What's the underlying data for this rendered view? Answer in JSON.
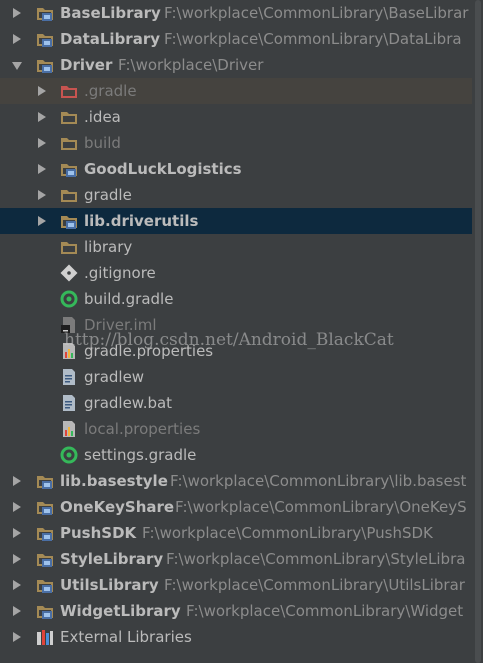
{
  "tree": {
    "BaseLibrary": {
      "label": "BaseLibrary",
      "path": "F:\\workplace\\CommonLibrary\\BaseLibrar"
    },
    "DataLibrary": {
      "label": "DataLibrary",
      "path": "F:\\workplace\\CommonLibrary\\DataLibra"
    },
    "Driver": {
      "label": "Driver",
      "path": "F:\\workplace\\Driver"
    },
    "gradle_hidden": {
      "label": ".gradle"
    },
    "idea": {
      "label": ".idea"
    },
    "build": {
      "label": "build"
    },
    "GoodLuckLogistics": {
      "label": "GoodLuckLogistics"
    },
    "gradle": {
      "label": "gradle"
    },
    "lib_driverutils": {
      "label": "lib.driverutils"
    },
    "library": {
      "label": "library"
    },
    "gitignore": {
      "label": ".gitignore"
    },
    "build_gradle": {
      "label": "build.gradle"
    },
    "driver_iml": {
      "label": "Driver.iml"
    },
    "gradle_properties": {
      "label": "gradle.properties"
    },
    "gradlew": {
      "label": "gradlew"
    },
    "gradlew_bat": {
      "label": "gradlew.bat"
    },
    "local_properties": {
      "label": "local.properties"
    },
    "settings_gradle": {
      "label": "settings.gradle"
    },
    "lib_basestyle": {
      "label": "lib.basestyle",
      "path": "F:\\workplace\\CommonLibrary\\lib.basest"
    },
    "OneKeyShare": {
      "label": "OneKeyShare",
      "path": "F:\\workplace\\CommonLibrary\\OneKeyS"
    },
    "PushSDK": {
      "label": "PushSDK",
      "path": "F:\\workplace\\CommonLibrary\\PushSDK"
    },
    "StyleLibrary": {
      "label": "StyleLibrary",
      "path": "F:\\workplace\\CommonLibrary\\StyleLibra"
    },
    "UtilsLibrary": {
      "label": "UtilsLibrary",
      "path": "F:\\workplace\\CommonLibrary\\UtilsLibrar"
    },
    "WidgetLibrary": {
      "label": "WidgetLibrary",
      "path": "F:\\workplace\\CommonLibrary\\Widget"
    },
    "external": {
      "label": "External Libraries"
    }
  },
  "watermark": "http://blog.csdn.net/Android_BlackCat",
  "colors": {
    "background": "#3c3f41",
    "selected": "#0d293e",
    "hover": "#45433f",
    "folder": "#a48a55",
    "gradle_green": "#35b85a"
  },
  "icons": {
    "module": "module-folder-icon",
    "folder": "folder-icon",
    "excluded": "excluded-folder-icon",
    "git": "gitignore-icon",
    "gradle": "gradle-file-icon",
    "iml": "iml-file-icon",
    "properties": "properties-file-icon",
    "text": "text-file-icon",
    "libraries": "external-libraries-icon"
  }
}
